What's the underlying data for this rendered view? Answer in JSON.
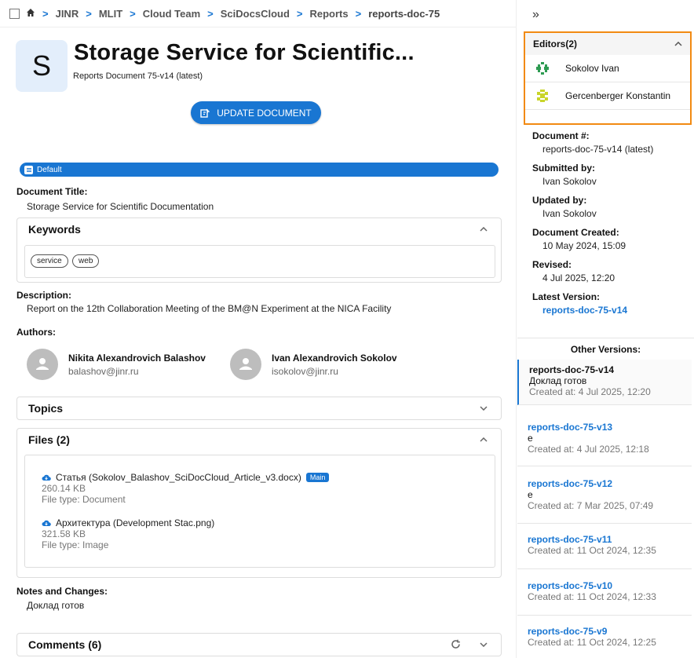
{
  "breadcrumb": {
    "items": [
      "JINR",
      "MLIT",
      "Cloud Team",
      "SciDocsCloud",
      "Reports",
      "reports-doc-75"
    ]
  },
  "header": {
    "avatar_letter": "S",
    "title": "Storage Service for Scientific...",
    "subtitle": "Reports Document 75-v14 (latest)",
    "update_button": "UPDATE DOCUMENT"
  },
  "template_badge": "Default",
  "document_title": {
    "label": "Document Title:",
    "value": "Storage Service for Scientific Documentation"
  },
  "keywords": {
    "label": "Keywords",
    "items": [
      "service",
      "web"
    ]
  },
  "description": {
    "label": "Description:",
    "value": "Report on the 12th Collaboration Meeting of the BM@N Experiment at the NICA Facility"
  },
  "authors": {
    "label": "Authors:",
    "items": [
      {
        "name": "Nikita Alexandrovich Balashov",
        "email": "balashov@jinr.ru"
      },
      {
        "name": "Ivan Alexandrovich Sokolov",
        "email": "isokolov@jinr.ru"
      }
    ]
  },
  "topics": {
    "label": "Topics"
  },
  "files": {
    "label": "Files (2)",
    "items": [
      {
        "name": "Статья (Sokolov_Balashov_SciDocCloud_Article_v3.docx)",
        "badge": "Main",
        "size": "260.14 KB",
        "type": "File type: Document"
      },
      {
        "name": "Архитектура (Development Stac.png)",
        "size": "321.58 KB",
        "type": "File type: Image"
      }
    ]
  },
  "notes": {
    "label": "Notes and Changes:",
    "value": "Доклад готов"
  },
  "comments": {
    "label": "Comments (6)"
  },
  "editors": {
    "label": "Editors(2)",
    "items": [
      "Sokolov Ivan",
      "Gercenberger Konstantin"
    ],
    "highlight_color": "#f28a12"
  },
  "details": {
    "document_no": {
      "label": "Document #:",
      "value": "reports-doc-75-v14 (latest)"
    },
    "submitted_by": {
      "label": "Submitted by:",
      "value": "Ivan Sokolov"
    },
    "updated_by": {
      "label": "Updated by:",
      "value": "Ivan Sokolov"
    },
    "created": {
      "label": "Document Created:",
      "value": "10 May 2024, 15:09"
    },
    "revised": {
      "label": "Revised:",
      "value": "4 Jul 2025, 12:20"
    },
    "latest": {
      "label": "Latest Version:",
      "value": "reports-doc-75-v14"
    }
  },
  "other_versions": {
    "label": "Other Versions:",
    "items": [
      {
        "name": "reports-doc-75-v14",
        "note": "Доклад готов",
        "created": "Created at: 4 Jul 2025, 12:20"
      },
      {
        "name": "reports-doc-75-v13",
        "note": "e",
        "created": "Created at: 4 Jul 2025, 12:18"
      },
      {
        "name": "reports-doc-75-v12",
        "note": "e",
        "created": "Created at: 7 Mar 2025, 07:49"
      },
      {
        "name": "reports-doc-75-v11",
        "note": "",
        "created": "Created at: 11 Oct 2024, 12:35"
      },
      {
        "name": "reports-doc-75-v10",
        "note": "",
        "created": "Created at: 11 Oct 2024, 12:33"
      },
      {
        "name": "reports-doc-75-v9",
        "note": "",
        "created": "Created at: 11 Oct 2024, 12:25"
      }
    ]
  },
  "colors": {
    "accent": "#1976d2"
  }
}
